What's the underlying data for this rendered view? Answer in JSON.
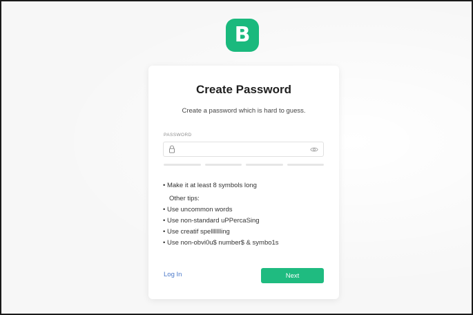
{
  "logo": {
    "letter": "B",
    "color": "#1ab97d"
  },
  "card": {
    "title": "Create Password",
    "subtitle": "Create a password which is hard to guess."
  },
  "password_field": {
    "label": "PASSWORD",
    "value": "",
    "placeholder": "",
    "lock_icon": "lock-icon",
    "toggle_icon": "eye-icon"
  },
  "strength_meter": {
    "segments": 4,
    "filled": 0,
    "empty_color": "#e6e6e6"
  },
  "tips": {
    "primary": "Make it at least 8 symbols long",
    "other_heading": "Other tips:",
    "items": [
      "Use uncommon words",
      "Use non-standard uPPercaSing",
      "Use creatif spellllllling",
      "Use non-obvi0u$ number$ & symbo1s"
    ]
  },
  "actions": {
    "login_label": "Log In",
    "next_label": "Next",
    "accent_color": "#1fbb80",
    "link_color": "#4a78c9"
  }
}
